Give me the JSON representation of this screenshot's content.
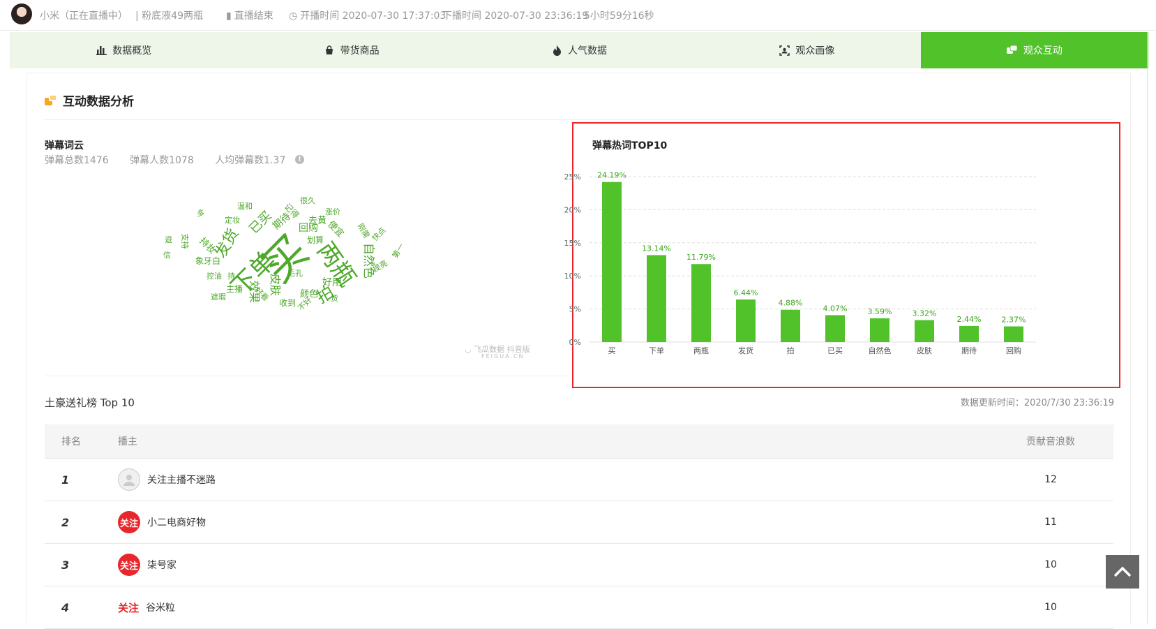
{
  "header": {
    "streamer": "小米（正在直播中）",
    "title": "| 粉底液49两瓶",
    "status": "直播结束",
    "start_time": "开播时间 2020-07-30 17:37:03",
    "end_time": "下播时间 2020-07-30 23:36:19",
    "duration": "5小时59分16秒"
  },
  "nav": [
    {
      "label": "数据概览",
      "icon": "bar-chart-icon"
    },
    {
      "label": "带货商品",
      "icon": "shopping-bag-icon"
    },
    {
      "label": "人气数据",
      "icon": "flame-icon"
    },
    {
      "label": "观众画像",
      "icon": "portrait-scan-icon"
    },
    {
      "label": "观众互动",
      "icon": "interaction-icon",
      "active": true
    }
  ],
  "section": {
    "title": "互动数据分析"
  },
  "wordcloud": {
    "title": "弹幕词云",
    "stats": [
      "弹幕总数1476",
      "弹幕人数1078",
      "人均弹幕数1.37"
    ],
    "words": [
      "买",
      "下单",
      "两瓶",
      "发货",
      "拍",
      "已买",
      "自然色",
      "皮肤",
      "期待",
      "回购",
      "很久",
      "温和",
      "支持",
      "退",
      "信",
      "象牙白",
      "持妆",
      "效果",
      "好用",
      "颜色",
      "收到",
      "遮瑕",
      "主播",
      "涨价",
      "便宜",
      "记得",
      "定妆",
      "刚需",
      "毛孔",
      "去黄",
      "划算",
      "持",
      "货",
      "不好",
      "快点",
      "提亮",
      "好看",
      "多",
      "第一",
      "控油"
    ]
  },
  "watermark": {
    "brand": "飞瓜数据",
    "tag": "抖音版",
    "url": "FEIGUA.CN"
  },
  "chart_data": {
    "type": "bar",
    "title": "弹幕热词TOP10",
    "categories": [
      "买",
      "下单",
      "两瓶",
      "发货",
      "拍",
      "已买",
      "自然色",
      "皮肤",
      "期待",
      "回购"
    ],
    "values": [
      24.19,
      13.14,
      11.79,
      6.44,
      4.88,
      4.07,
      3.59,
      3.32,
      2.44,
      2.37
    ],
    "value_labels": [
      "24.19%",
      "13.14%",
      "11.79%",
      "6.44%",
      "4.88%",
      "4.07%",
      "3.59%",
      "3.32%",
      "2.44%",
      "2.37%"
    ],
    "ylim": [
      0,
      25
    ],
    "yticks": [
      "0%",
      "5%",
      "10%",
      "15%",
      "20%",
      "25%"
    ],
    "ytick_values": [
      0,
      5,
      10,
      15,
      20,
      25
    ],
    "grid": true,
    "color": "#52c22b"
  },
  "gifts": {
    "title": "土豪送礼榜 Top 10",
    "update_time": "数据更新时间：2020/7/30 23:36:19",
    "columns": [
      "排名",
      "播主",
      "贡献音浪数"
    ],
    "rows": [
      {
        "rank": "1",
        "name": "关注主播不迷路",
        "value": "12",
        "avatar": "grey"
      },
      {
        "rank": "2",
        "name": "小二电商好物",
        "value": "11",
        "avatar": "red",
        "badge": "关注"
      },
      {
        "rank": "3",
        "name": "柒号家",
        "value": "10",
        "avatar": "red",
        "badge": "关注"
      },
      {
        "rank": "4",
        "name": "谷米粒",
        "value": "10",
        "avatar": "text",
        "badge": "关注"
      }
    ]
  },
  "back_to_top": "chevron-up-icon"
}
